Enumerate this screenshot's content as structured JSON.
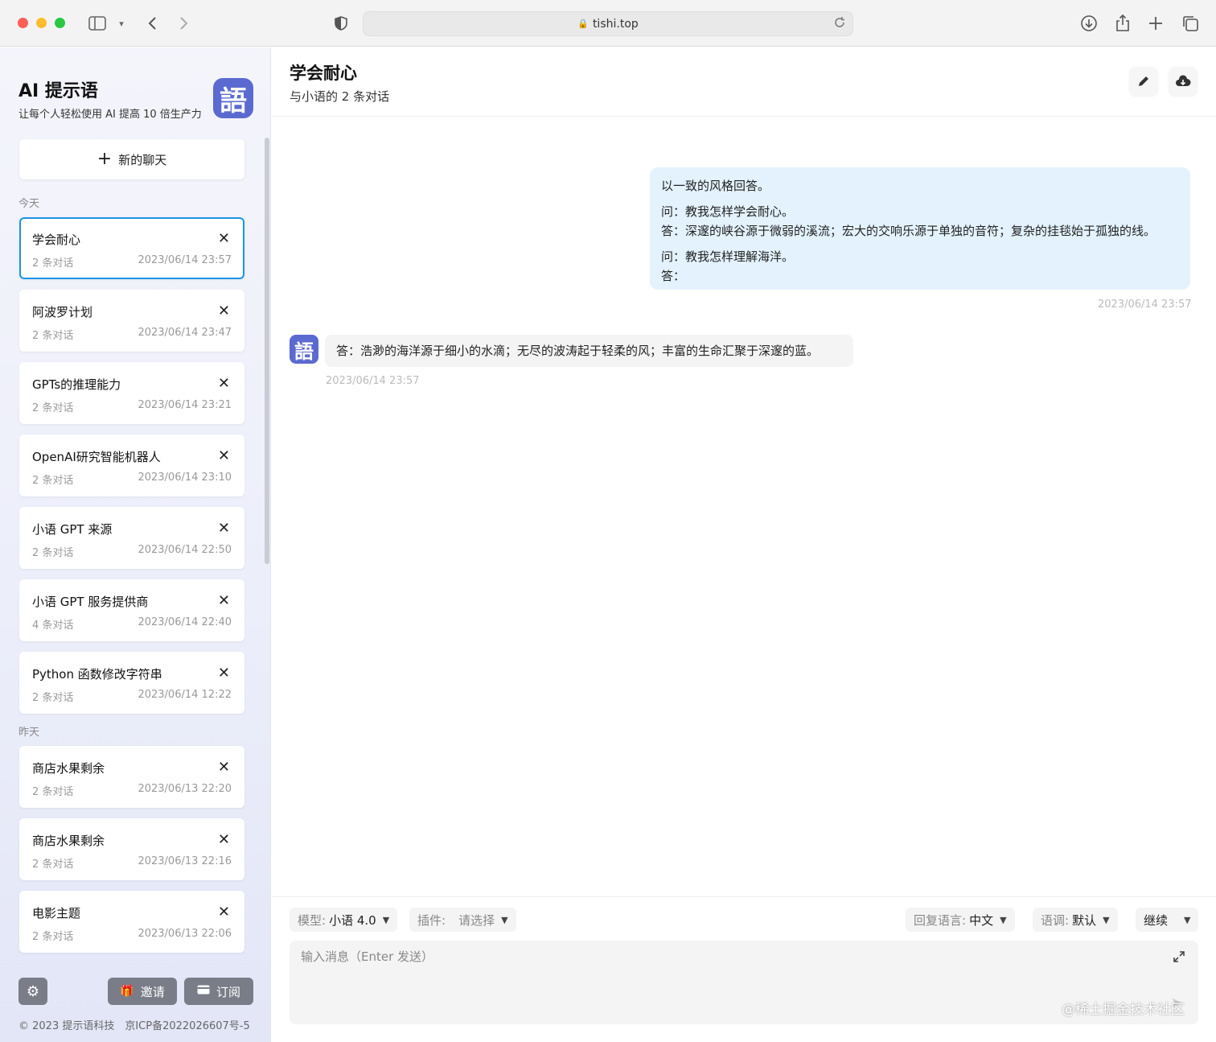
{
  "browser": {
    "url": "tishi.top"
  },
  "sidebar": {
    "brand_title": "AI 提示语",
    "brand_subtitle": "让每个人轻松使用 AI 提高 10 倍生产力",
    "logo_text": "語",
    "new_chat_label": "新的聊天",
    "groups": [
      {
        "label": "今天"
      },
      {
        "label": "昨天"
      }
    ],
    "chats": [
      {
        "title": "学会耐心",
        "count": "2 条对话",
        "date": "2023/06/14 23:57"
      },
      {
        "title": "阿波罗计划",
        "count": "2 条对话",
        "date": "2023/06/14 23:47"
      },
      {
        "title": "GPTs的推理能力",
        "count": "2 条对话",
        "date": "2023/06/14 23:21"
      },
      {
        "title": "OpenAI研究智能机器人",
        "count": "2 条对话",
        "date": "2023/06/14 23:10"
      },
      {
        "title": "小语 GPT 来源",
        "count": "2 条对话",
        "date": "2023/06/14 22:50"
      },
      {
        "title": "小语 GPT 服务提供商",
        "count": "4 条对话",
        "date": "2023/06/14 22:40"
      },
      {
        "title": "Python 函数修改字符串",
        "count": "2 条对话",
        "date": "2023/06/14 12:22"
      },
      {
        "title": "商店水果剩余",
        "count": "2 条对话",
        "date": "2023/06/13 22:20"
      },
      {
        "title": "商店水果剩余",
        "count": "2 条对话",
        "date": "2023/06/13 22:16"
      },
      {
        "title": "电影主题",
        "count": "2 条对话",
        "date": "2023/06/13 22:06"
      }
    ],
    "invite_label": "邀请",
    "subscribe_label": "订阅",
    "footer": "© 2023 提示语科技　京ICP备2022026607号-5"
  },
  "main": {
    "title": "学会耐心",
    "subtitle": "与小语的 2 条对话",
    "user_message": {
      "line1": "以一致的风格回答。",
      "line2": "问：教我怎样学会耐心。",
      "line3": "答：深邃的峡谷源于微弱的溪流；宏大的交响乐源于单独的音符；复杂的挂毯始于孤独的线。",
      "line4": "问：教我怎样理解海洋。",
      "line5": "答：",
      "time": "2023/06/14 23:57"
    },
    "ai_message": {
      "text": "答：浩渺的海洋源于细小的水滴；无尽的波涛起于轻柔的风；丰富的生命汇聚于深邃的蓝。",
      "time": "2023/06/14 23:57"
    },
    "toolbar": {
      "model_label": "模型:",
      "model_value": "小语 4.0",
      "plugin_label": "插件:",
      "plugin_value": "请选择",
      "reply_lang_label": "回复语言:",
      "reply_lang_value": "中文",
      "tone_label": "语调:",
      "tone_value": "默认",
      "continue_label": "继续"
    },
    "input_placeholder": "输入消息（Enter 发送）"
  },
  "watermark": "@稀土掘金技术社区",
  "colors": {
    "accent": "#1d93e3",
    "logo": "#5b6ad0",
    "user_bubble": "#e3f2fd"
  }
}
